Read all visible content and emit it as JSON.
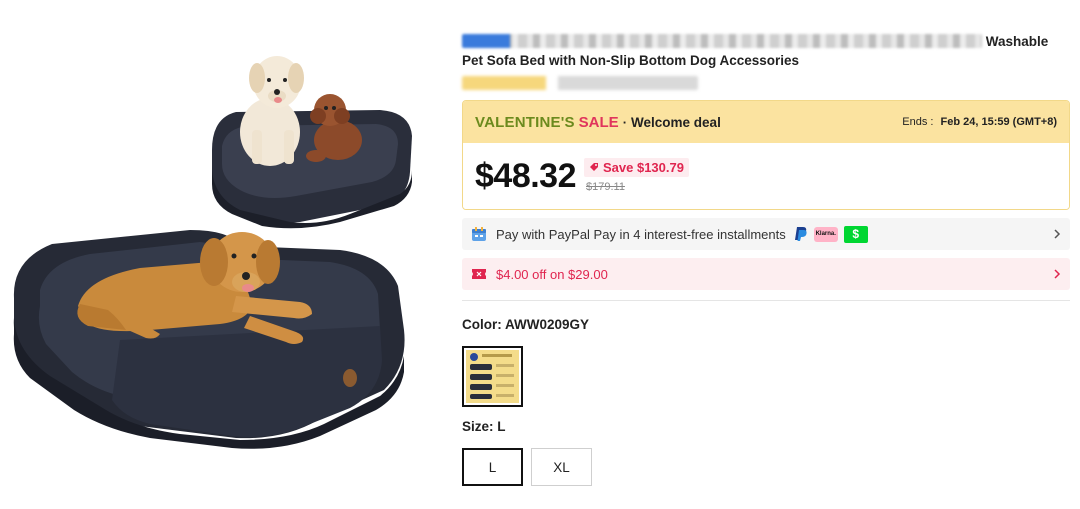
{
  "product": {
    "title_visible_suffix": "Washable",
    "title_line2": "Pet Sofa Bed with Non-Slip Bottom Dog Accessories"
  },
  "sale": {
    "word1": "VALENTINE'S",
    "word2": "SALE",
    "separator": "·",
    "deal": "Welcome deal",
    "ends_label": "Ends :",
    "ends_value": "Feb 24, 15:59 (GMT+8)",
    "price": "$48.32",
    "save": "Save $130.79",
    "old_price": "$179.11"
  },
  "promos": {
    "paypal_text": "Pay with PayPal Pay in 4 interest-free installments",
    "klarna": "Klarna.",
    "cashapp": "$",
    "coupon_text": "$4.00 off on $29.00"
  },
  "color": {
    "label": "Color: AWW0209GY"
  },
  "size": {
    "label": "Size: L",
    "options": [
      "L",
      "XL"
    ],
    "selected": "L"
  },
  "colors": {
    "sale_bg": "#fbe3a0",
    "sale_green": "#6b8a1d",
    "accent_red": "#e0254f",
    "cashapp_green": "#00d632",
    "klarna_pink": "#ffb3c7"
  },
  "icons": [
    "tag-icon",
    "paypal-calendar-icon",
    "paypal-logo-icon",
    "coupon-ticket-icon",
    "chevron-right-icon"
  ]
}
